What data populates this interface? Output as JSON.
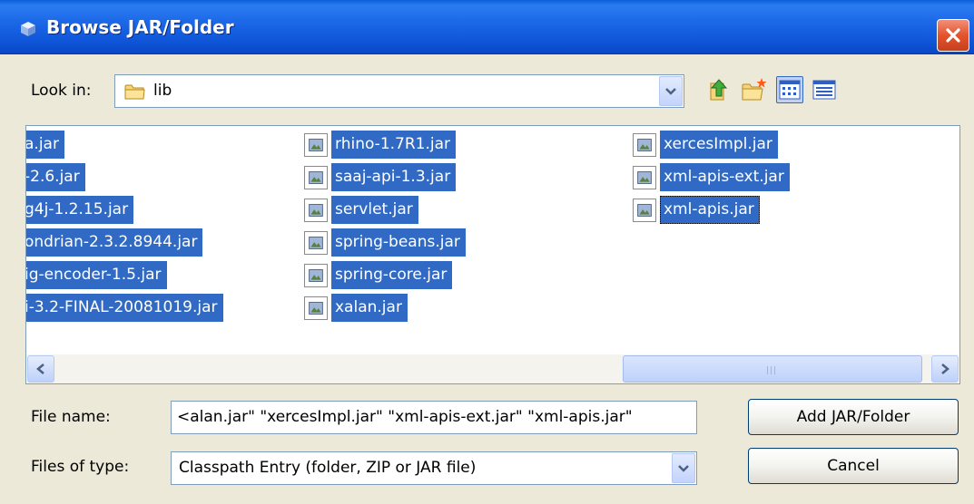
{
  "window": {
    "title": "Browse JAR/Folder",
    "title_icon": "java-cube-icon",
    "close_icon": "close-icon"
  },
  "look_in": {
    "label": "Look in:",
    "value": "lib",
    "folder_icon": "folder-icon"
  },
  "toolbar": {
    "up_icon": "up-one-level-icon",
    "new_folder_icon": "create-new-folder-icon",
    "list_icon": "list-view-icon",
    "details_icon": "details-view-icon"
  },
  "files": {
    "column1": [
      "a.jar",
      "-2.6.jar",
      "g4j-1.2.15.jar",
      "ondrian-2.3.2.8944.jar",
      "ig-encoder-1.5.jar",
      "i-3.2-FINAL-20081019.jar"
    ],
    "column2": [
      "rhino-1.7R1.jar",
      "saaj-api-1.3.jar",
      "servlet.jar",
      "spring-beans.jar",
      "spring-core.jar",
      "xalan.jar"
    ],
    "column3": [
      "xercesImpl.jar",
      "xml-apis-ext.jar",
      "xml-apis.jar"
    ]
  },
  "file_name": {
    "label": "File name:",
    "value": "<alan.jar\" \"xercesImpl.jar\" \"xml-apis-ext.jar\" \"xml-apis.jar\""
  },
  "files_of_type": {
    "label": "Files of type:",
    "value": "Classpath Entry (folder, ZIP or JAR file)"
  },
  "buttons": {
    "add": "Add JAR/Folder",
    "cancel": "Cancel"
  },
  "colors": {
    "selection": "#316ac5",
    "titlebar": "#0a5fd9",
    "dialog_bg": "#ece9d8"
  }
}
